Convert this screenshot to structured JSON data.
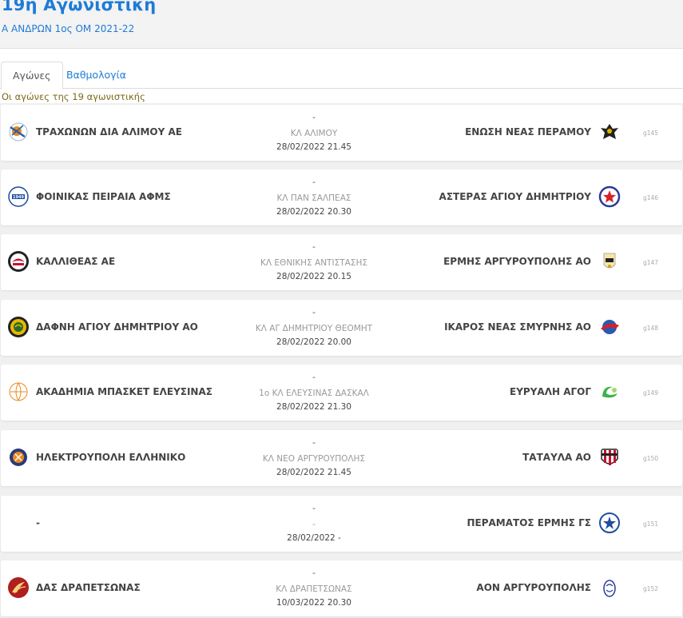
{
  "header": {
    "title": "19η Αγωνιστική",
    "subtitle": "Α ΑΝΔΡΩΝ 1ος ΟΜ 2021-22"
  },
  "tabs": [
    {
      "label": "Αγώνες"
    },
    {
      "label": "Βαθμολογία"
    }
  ],
  "caption": "Οι αγώνες της 19 αγωνιστικής",
  "games": [
    {
      "home": "ΤΡΑΧΩΝΩΝ ΔΙΑ ΑΛΙΜΟΥ ΑΕ",
      "away": "ΕΝΩΣΗ ΝΕΑΣ ΠΕΡΑΜΟΥ",
      "score": "-",
      "venue": "ΚΛ ΑΛΙΜΟΥ",
      "datetime": "28/02/2022 21.45",
      "code": "g145",
      "home_logo": "basketball-hand-logo",
      "away_logo": "eagle-logo"
    },
    {
      "home": "ΦΟΙΝΙΚΑΣ ΠΕΙΡΑΙΑ ΑΦΜΣ",
      "away": "ΑΣΤΕΡΑΣ ΑΓΙΟΥ ΔΗΜΗΤΡΙΟΥ",
      "score": "-",
      "venue": "ΚΛ ΠΑΝ ΣΑΛΠΕΑΣ",
      "datetime": "28/02/2022 20.30",
      "code": "g146",
      "home_logo": "phoenix-1949-logo",
      "away_logo": "star-logo"
    },
    {
      "home": "ΚΑΛΛΙΘΕΑΣ ΑΕ",
      "away": "ΕΡΜΗΣ ΑΡΓΥΡΟΥΠΟΛΗΣ ΑΟ",
      "score": "-",
      "venue": "ΚΛ ΕΘΝΙΚΗΣ ΑΝΤΙΣΤΑΣΗΣ",
      "datetime": "28/02/2022 20.15",
      "code": "g147",
      "home_logo": "kallithea-logo",
      "away_logo": "hermes-logo"
    },
    {
      "home": "ΔΑΦΝΗ ΑΓΙΟΥ ΔΗΜΗΤΡΙΟΥ ΑΟ",
      "away": "ΙΚΑΡΟΣ ΝΕΑΣ ΣΜΥΡΝΗΣ ΑΟ",
      "score": "-",
      "venue": "ΚΛ ΑΓ ΔΗΜΗΤΡΙΟΥ ΘΕΟΜΗΤ",
      "datetime": "28/02/2022 20.00",
      "code": "g148",
      "home_logo": "laurel-logo",
      "away_logo": "ikaros-logo"
    },
    {
      "home": "ΑΚΑΔΗΜΙΑ ΜΠΑΣΚΕΤ ΕΛΕΥΣΙΝΑΣ",
      "away": "ΕΥΡΥΑΛΗ ΑΓΟΓ",
      "score": "-",
      "venue": "1ο ΚΛ ΕΛΕΥΣΙΝΑΣ ΔΑΣΚΑΛ",
      "datetime": "28/02/2022 21.30",
      "code": "g149",
      "home_logo": "academy-logo",
      "away_logo": "evryali-logo"
    },
    {
      "home": "ΗΛΕΚΤΡΟΥΠΟΛΗ ΕΛΛΗΝΙΚΟ",
      "away": "ΤΑΤΑΥΛΑ ΑΟ",
      "score": "-",
      "venue": "ΚΛ ΝΕΟ ΑΡΓΥΡΟΥΠΟΛΗΣ",
      "datetime": "28/02/2022 21.45",
      "code": "g150",
      "home_logo": "ilektroupoli-logo",
      "away_logo": "striped-shield-logo"
    },
    {
      "home": "-",
      "away": "ΠΕΡΑΜΑΤΟΣ ΕΡΜΗΣ ΓΣ",
      "score": "-",
      "venue": "-",
      "datetime": "28/02/2022 -",
      "code": "g151",
      "home_logo": "",
      "away_logo": "perama-logo"
    },
    {
      "home": "ΔΑΣ ΔΡΑΠΕΤΣΩΝΑΣ",
      "away": "ΑΟΝ ΑΡΓΥΡΟΥΠΟΛΗΣ",
      "score": "-",
      "venue": "ΚΛ ΔΡΑΠΕΤΣΩΝΑΣ",
      "datetime": "10/03/2022 20.30",
      "code": "g152",
      "home_logo": "das-logo",
      "away_logo": "aon-logo"
    }
  ]
}
